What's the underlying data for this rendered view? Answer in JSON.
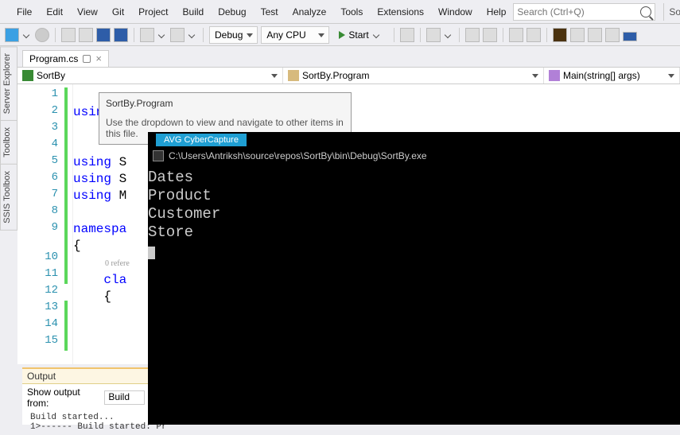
{
  "menu": {
    "items": [
      "File",
      "Edit",
      "View",
      "Git",
      "Project",
      "Build",
      "Debug",
      "Test",
      "Analyze",
      "Tools",
      "Extensions",
      "Window",
      "Help"
    ]
  },
  "search": {
    "placeholder": "Search (Ctrl+Q)"
  },
  "right_trunc": "Sort",
  "toolbar": {
    "config": "Debug",
    "platform": "Any CPU",
    "start": "Start"
  },
  "side_tabs": [
    "Server Explorer",
    "Toolbox",
    "SSIS Toolbox"
  ],
  "doc_tab": {
    "label": "Program.cs"
  },
  "nav": {
    "scope": "SortBy",
    "class": "SortBy.Program",
    "method": "Main(string[] args)"
  },
  "tooltip": {
    "title": "SortBy.Program",
    "hint": "Use the dropdown to view and navigate to other items in this file."
  },
  "code": {
    "lines": [
      "using System;",
      "",
      "",
      "using S",
      "using S",
      "using M",
      "",
      "namespa",
      "{",
      "",
      "    cla",
      "    {",
      "",
      "",
      "",
      ""
    ],
    "ref_lens": "0 refere"
  },
  "capture_tag": "AVG CyberCapture",
  "console": {
    "title": "C:\\Users\\Antriksh\\source\\repos\\SortBy\\bin\\Debug\\SortBy.exe",
    "lines": [
      "Dates",
      "Product",
      "Customer",
      "Store"
    ]
  },
  "output": {
    "title": "Output",
    "from_label": "Show output from:",
    "from_value": "Build",
    "text": "Build started...\n1>------ Build started: Pr"
  }
}
